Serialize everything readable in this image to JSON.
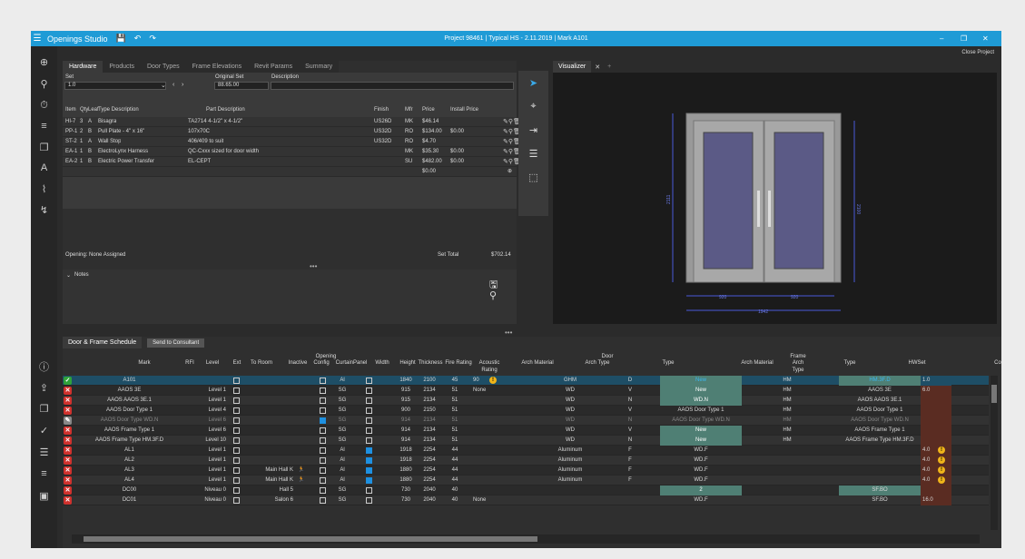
{
  "titlebar": {
    "app_name": "Openings Studio",
    "project": "Project 98461 | Typical HS - 2.11.2019 | Mark A101",
    "menu_icon": "hamburger-icon",
    "close_project": "Close Project"
  },
  "hardware": {
    "tabs": [
      "Hardware",
      "Products",
      "Door Types",
      "Frame Elevations",
      "Revit Params",
      "Summary"
    ],
    "set_label": "Set",
    "set_value": "1.0",
    "original_set_label": "Original Set",
    "original_set_value": "88.65.00",
    "description_label": "Description",
    "description_value": "",
    "columns": [
      "Item",
      "Qty",
      "Leaf",
      "Type Description",
      "Part Description",
      "Finish",
      "Mfr",
      "Price",
      "Install Price"
    ],
    "rows": [
      [
        "HI-7",
        "3",
        "A",
        "Bisagra",
        "TA2714 4-1/2\" x 4-1/2\"",
        "US26D",
        "MK",
        "$46.14",
        ""
      ],
      [
        "PP-1",
        "2",
        "B",
        "Pull Plate - 4\" x 16\"",
        "107x70C",
        "US32D",
        "RO",
        "$134.00",
        "$0.00"
      ],
      [
        "ST-2",
        "1",
        "A",
        "Wall Stop",
        "406/409 to suit",
        "US32D",
        "RO",
        "$4.70",
        ""
      ],
      [
        "EA-1",
        "1",
        "B",
        "ElectroLynx Harness",
        "QC-Cxxx sized for door width",
        "",
        "MK",
        "$35.30",
        "$0.00"
      ],
      [
        "EA-2",
        "1",
        "B",
        "Electric Power Transfer",
        "EL-CEPT",
        "",
        "SU",
        "$482.00",
        "$0.00"
      ],
      [
        "",
        "",
        "",
        "",
        "",
        "",
        "",
        "$0.00",
        ""
      ]
    ],
    "opening_label": "Opening: None Assigned",
    "set_total_label": "Set Total",
    "set_total_value": "$702.14",
    "notes_label": "Notes"
  },
  "visualizer": {
    "tab_label": "Visualizer",
    "dim_height_left": "2111",
    "dim_height_right": "2100",
    "dim_leaf_left": "920",
    "dim_leaf_right": "920",
    "dim_total": "1942",
    "frame_color": "#9a9a9a",
    "glass_color": "#5b5a86"
  },
  "schedule": {
    "tabs": [
      "Door & Frame Schedule"
    ],
    "send_button": "Send to Consultant",
    "group_opening": "Opening",
    "group_door": "Door",
    "group_frame": "Frame",
    "headers": [
      "Mark",
      "RFI",
      "Level",
      "Ext",
      "To Room",
      "Inactive",
      "Config",
      "CurtainPanel",
      "Width",
      "Height",
      "Thickness",
      "Fire Rating",
      "Acoustic Rating",
      "Arch Material",
      "Arch Type",
      "Type",
      "Arch Material",
      "Arch Type",
      "Type",
      "HWSet",
      "Comm"
    ],
    "rows": [
      {
        "status": "ok",
        "mark": "A101",
        "level": "",
        "ext": false,
        "to_room": "",
        "inactive": false,
        "config": "Al",
        "curtain": false,
        "width": "1840",
        "height": "2100",
        "thickness": "45",
        "fire": "90",
        "fire_warn": true,
        "acoustic": "",
        "door_mat": "GHM",
        "door_type": "D",
        "door_typecell": "New",
        "frame_mat": "HM",
        "frame_archtype": "",
        "frame_type": "HM.3F.D",
        "hwset": "1.0",
        "selected": true
      },
      {
        "status": "err",
        "mark": "AAOS 3E",
        "level": "Level 1",
        "ext": false,
        "to_room": "",
        "inactive": false,
        "config": "SG",
        "curtain": false,
        "width": "915",
        "height": "2134",
        "thickness": "51",
        "fire": "None",
        "fire_warn": false,
        "acoustic": "",
        "door_mat": "WD",
        "door_type": "V",
        "door_typecell": "New",
        "frame_mat": "HM",
        "frame_archtype": "",
        "frame_type": "AAOS 3E",
        "hwset": "6.0"
      },
      {
        "status": "err",
        "mark": "AAOS AAOS 3E.1",
        "level": "Level 1",
        "ext": false,
        "to_room": "",
        "inactive": false,
        "config": "SG",
        "curtain": false,
        "width": "915",
        "height": "2134",
        "thickness": "51",
        "fire": "",
        "fire_warn": false,
        "acoustic": "",
        "door_mat": "WD",
        "door_type": "N",
        "door_typecell": "WD.N",
        "frame_mat": "HM",
        "frame_archtype": "",
        "frame_type": "AAOS AAOS 3E.1",
        "hwset": ""
      },
      {
        "status": "err",
        "mark": "AAOS Door Type 1",
        "level": "Level 4",
        "ext": false,
        "to_room": "",
        "inactive": false,
        "config": "SG",
        "curtain": false,
        "width": "900",
        "height": "2150",
        "thickness": "51",
        "fire": "",
        "fire_warn": false,
        "acoustic": "",
        "door_mat": "WD",
        "door_type": "V",
        "door_typecell": "AAOS Door Type 1",
        "frame_mat": "HM",
        "frame_archtype": "",
        "frame_type": "AAOS Door Type 1",
        "hwset": ""
      },
      {
        "status": "edit",
        "mark": "AAOS Door Type WD.N",
        "level": "Level 6",
        "ext": false,
        "to_room": "",
        "inactive": true,
        "config": "SG",
        "curtain": false,
        "width": "914",
        "height": "2134",
        "thickness": "51",
        "fire": "",
        "fire_warn": false,
        "acoustic": "",
        "door_mat": "WD",
        "door_type": "N",
        "door_typecell": "AAOS Door Type WD.N",
        "frame_mat": "HM",
        "frame_archtype": "",
        "frame_type": "AAOS Door Type WD.N",
        "hwset": "",
        "disabled": true
      },
      {
        "status": "err",
        "mark": "AAOS Frame Type 1",
        "level": "Level 6",
        "ext": false,
        "to_room": "",
        "inactive": false,
        "config": "SG",
        "curtain": false,
        "width": "914",
        "height": "2134",
        "thickness": "51",
        "fire": "",
        "fire_warn": false,
        "acoustic": "",
        "door_mat": "WD",
        "door_type": "V",
        "door_typecell": "New",
        "frame_mat": "HM",
        "frame_archtype": "",
        "frame_type": "AAOS Frame Type 1",
        "hwset": ""
      },
      {
        "status": "err",
        "mark": "AAOS Frame Type HM.3F.D",
        "level": "Level 10",
        "ext": false,
        "to_room": "",
        "inactive": false,
        "config": "SG",
        "curtain": false,
        "width": "914",
        "height": "2134",
        "thickness": "51",
        "fire": "",
        "fire_warn": false,
        "acoustic": "",
        "door_mat": "WD",
        "door_type": "N",
        "door_typecell": "New",
        "frame_mat": "HM",
        "frame_archtype": "",
        "frame_type": "AAOS Frame Type HM.3F.D",
        "hwset": ""
      },
      {
        "status": "err",
        "mark": "AL1",
        "level": "Level 1",
        "ext": false,
        "to_room": "",
        "inactive": false,
        "config": "Al",
        "curtain": true,
        "width": "1918",
        "height": "2254",
        "thickness": "44",
        "fire": "",
        "fire_warn": false,
        "acoustic": "",
        "door_mat": "Aluminum",
        "door_type": "F",
        "door_typecell": "WD.F",
        "frame_mat": "",
        "frame_archtype": "",
        "frame_type": "",
        "hwset": "4.0",
        "hw_warn": true
      },
      {
        "status": "err",
        "mark": "AL2",
        "level": "Level 1",
        "ext": false,
        "to_room": "",
        "inactive": false,
        "config": "Al",
        "curtain": true,
        "width": "1918",
        "height": "2254",
        "thickness": "44",
        "fire": "",
        "fire_warn": false,
        "acoustic": "",
        "door_mat": "Aluminum",
        "door_type": "F",
        "door_typecell": "WD.F",
        "frame_mat": "",
        "frame_archtype": "",
        "frame_type": "",
        "hwset": "4.0",
        "hw_warn": true
      },
      {
        "status": "err",
        "mark": "AL3",
        "level": "Level 1",
        "ext": false,
        "to_room": "Main Hall K",
        "inactive": false,
        "config": "Al",
        "curtain": true,
        "width": "1880",
        "height": "2254",
        "thickness": "44",
        "fire": "",
        "fire_warn": false,
        "acoustic": "",
        "door_mat": "Aluminum",
        "door_type": "F",
        "door_typecell": "WD.F",
        "frame_mat": "",
        "frame_archtype": "",
        "frame_type": "",
        "hwset": "4.0",
        "hw_warn": true,
        "runner": true
      },
      {
        "status": "err",
        "mark": "AL4",
        "level": "Level 1",
        "ext": false,
        "to_room": "Main Hall K",
        "inactive": false,
        "config": "Al",
        "curtain": true,
        "width": "1880",
        "height": "2254",
        "thickness": "44",
        "fire": "",
        "fire_warn": false,
        "acoustic": "",
        "door_mat": "Aluminum",
        "door_type": "F",
        "door_typecell": "WD.F",
        "frame_mat": "",
        "frame_archtype": "",
        "frame_type": "",
        "hwset": "4.0",
        "hw_warn": true,
        "runner": true
      },
      {
        "status": "err",
        "mark": "DC00",
        "level": "Niveau 0",
        "ext": false,
        "to_room": "Hall 5",
        "inactive": false,
        "config": "SG",
        "curtain": false,
        "width": "730",
        "height": "2040",
        "thickness": "40",
        "fire": "",
        "fire_warn": false,
        "acoustic": "",
        "door_mat": "",
        "door_type": "",
        "door_typecell": "2",
        "frame_mat": "",
        "frame_archtype": "",
        "frame_type": "SF.BO",
        "hwset": ""
      },
      {
        "status": "err",
        "mark": "DC01",
        "level": "Niveau 0",
        "ext": false,
        "to_room": "Salon 6",
        "inactive": false,
        "config": "SG",
        "curtain": false,
        "width": "730",
        "height": "2040",
        "thickness": "40",
        "fire": "None",
        "fire_warn": false,
        "acoustic": "",
        "door_mat": "",
        "door_type": "",
        "door_typecell": "WD.F",
        "frame_mat": "",
        "frame_archtype": "",
        "frame_type": "SF.BO",
        "hwset": "16.0"
      }
    ]
  },
  "colors": {
    "accent": "#1f9bd6",
    "ok": "#2fa23a",
    "err": "#d0312d",
    "new_cell": "#4f7f74",
    "hw_cell": "#5a2c22"
  }
}
